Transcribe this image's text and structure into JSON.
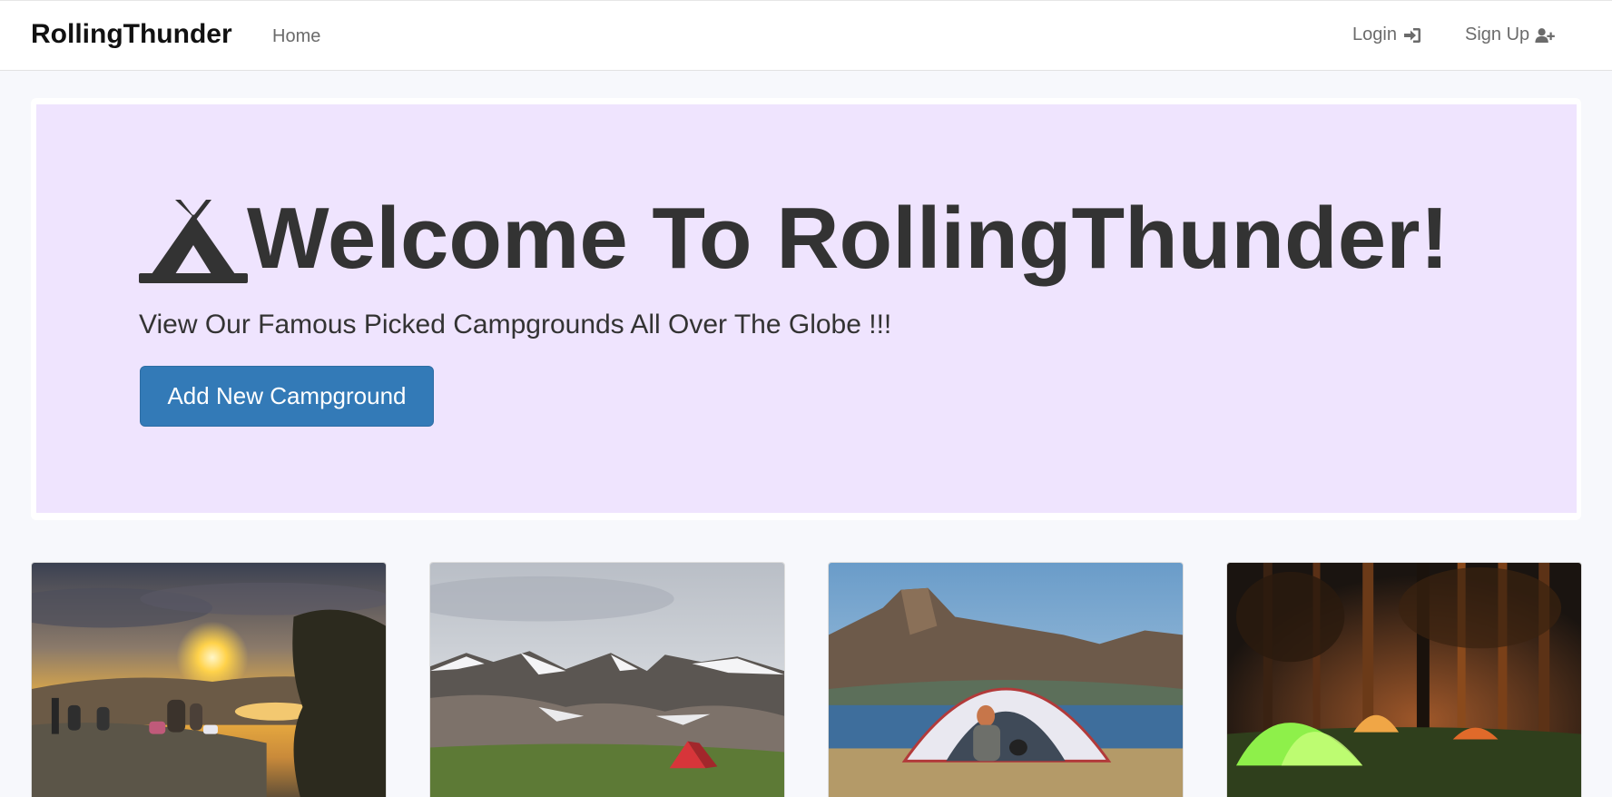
{
  "navbar": {
    "brand": "RollingThunder",
    "home_label": "Home",
    "login_label": "Login",
    "signup_label": "Sign Up",
    "login_icon": "sign-in-icon",
    "signup_icon": "user-plus-icon"
  },
  "hero": {
    "icon": "campground-icon",
    "title": "Welcome To RollingThunder!",
    "subtitle": "View Our Famous Picked Campgrounds All Over The Globe !!!",
    "add_button_label": "Add New Campground",
    "background_color": "#efe4fe",
    "button_color": "#337ab7"
  },
  "campgrounds": [
    {
      "image": "sunset-hilltop-campers-photo"
    },
    {
      "image": "snowy-mountains-red-tent-photo"
    },
    {
      "image": "lakeside-tent-mountain-photo"
    },
    {
      "image": "night-forest-tents-photo"
    }
  ]
}
